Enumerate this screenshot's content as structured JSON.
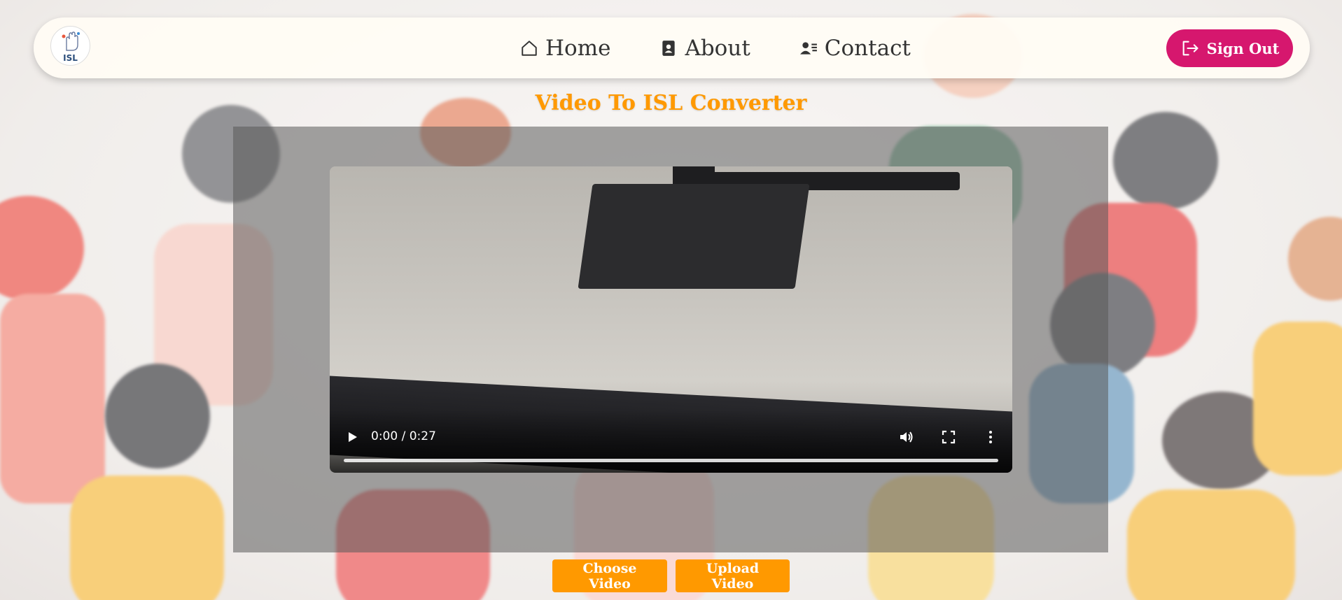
{
  "nav": {
    "logo_text": "ISL",
    "items": [
      {
        "label": "Home",
        "icon": "home-icon"
      },
      {
        "label": "About",
        "icon": "contact-book-icon"
      },
      {
        "label": "Contact",
        "icon": "person-card-icon"
      }
    ],
    "signout_label": "Sign Out"
  },
  "page": {
    "title": "Video To ISL Converter"
  },
  "video": {
    "time_display": "0:00 / 0:27",
    "progress": 0.0
  },
  "actions": {
    "choose_label": "Choose Video",
    "upload_label": "Upload Video"
  },
  "colors": {
    "accent": "#ff9900",
    "signout": "#d6176e",
    "nav_bg": "#fffcf4"
  }
}
